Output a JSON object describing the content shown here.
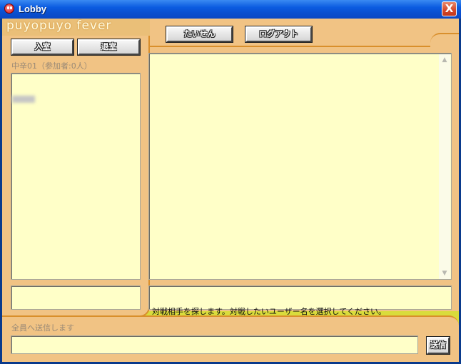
{
  "window": {
    "title": "Lobby",
    "close_glyph": "X",
    "icon": "puyo-app-icon"
  },
  "brand": "puyopuyo fever",
  "room": {
    "enter_label": "入室",
    "leave_label": "退室",
    "room_info": "中辛01（参加者:0人）",
    "users": [
      "user"
    ]
  },
  "top_buttons": {
    "battle_label": "たいせん",
    "logout_label": "ログアウト"
  },
  "status_message": "対戦相手を探します。対戦したいユーザー名を選択してください。",
  "chat": {
    "to_label": "全員へ送信します",
    "input_value": "",
    "send_label": "送信"
  },
  "colors": {
    "background": "#d9dc3c",
    "frame": "#f1c384",
    "frame_border": "#d98f2c",
    "panel": "#ffffc8",
    "titlebar": "#0b5be0"
  }
}
